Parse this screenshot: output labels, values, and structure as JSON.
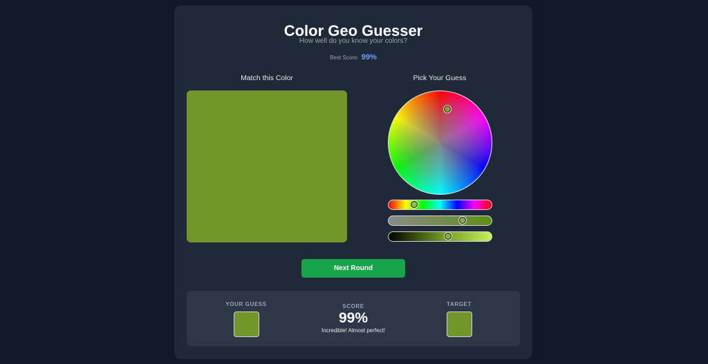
{
  "header": {
    "title": "Color Geo Guesser",
    "subtitle": "How well do you know your colors?",
    "best_score_label": "Best Score:",
    "best_score_value": "99%"
  },
  "target_section": {
    "label": "Match this Color",
    "color": "#72962a"
  },
  "picker": {
    "label": "Pick Your Guess",
    "wheel_selected_color": "#8fa035",
    "hue_level": 0.25,
    "saturation_level": 0.72,
    "lightness_level": 0.58,
    "hue_handle_color": "#8cc33b",
    "saturation_handle_color": "#8fa84b",
    "lightness_handle_color": "#8cb040",
    "saturation_track": [
      "#8a8a8a",
      "#5f8f14"
    ],
    "lightness_track": [
      "#000000",
      "#6b9322",
      "#c6f25a"
    ]
  },
  "actions": {
    "next_round_label": "Next Round"
  },
  "result": {
    "guess_label": "YOUR GUESS",
    "guess_color": "#72962a",
    "score_label": "SCORE",
    "score_value": "99%",
    "score_message": "Incredible! Almost perfect!",
    "target_label": "TARGET",
    "target_color": "#72962a"
  },
  "colors": {
    "background": "#111827",
    "card": "#1f2937",
    "accent_button": "#16a34a",
    "best_score": "#60a5fa"
  }
}
